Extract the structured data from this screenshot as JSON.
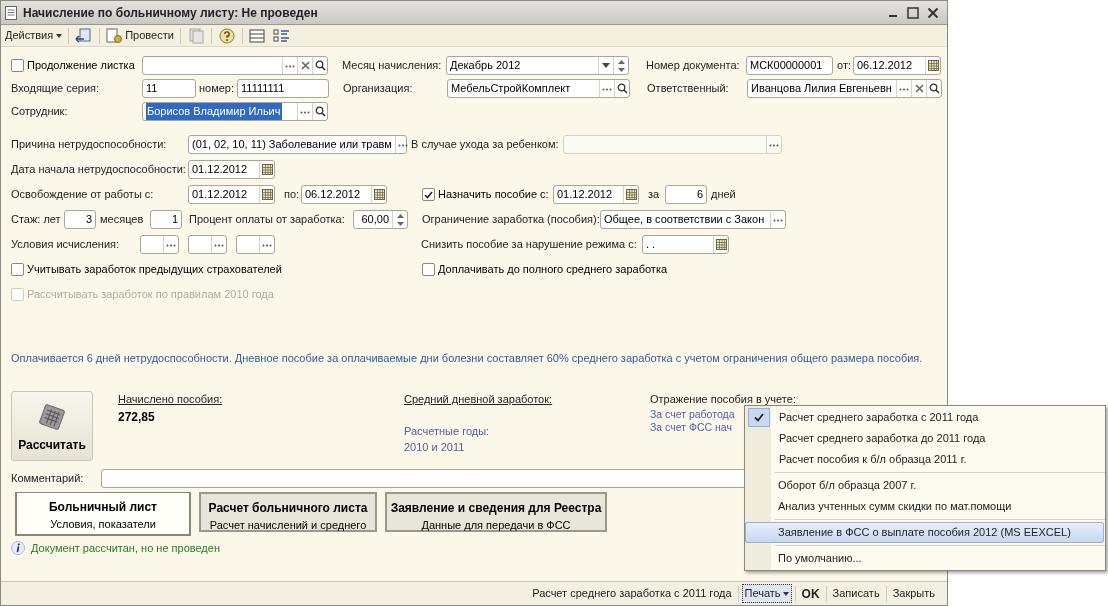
{
  "window": {
    "title": "Начисление по больничному листу: Не проведен"
  },
  "toolbar": {
    "actions": "Действия",
    "post": "Провести"
  },
  "header": {
    "continuation": {
      "label": "Продолжение листка",
      "checked": false
    },
    "series": {
      "label": "Входящие серия:",
      "value": "11"
    },
    "number": {
      "label": "номер:",
      "value": "11111111"
    },
    "employee": {
      "label": "Сотрудник:",
      "value": "Борисов Владимир Ильич",
      "selected": true
    },
    "month": {
      "label": "Месяц начисления:",
      "value": "Декабрь 2012"
    },
    "organization": {
      "label": "Организация:",
      "value": "МебельСтройКомплект"
    },
    "doc_number": {
      "label": "Номер документа:",
      "value": "МСК00000001"
    },
    "doc_date": {
      "label": "от:",
      "value": "06.12.2012"
    },
    "responsible": {
      "label": "Ответственный:",
      "value": "Иванцова Лилия Евгеньевн"
    }
  },
  "conditions": {
    "reason": {
      "label": "Причина нетрудоспособности:",
      "value": "(01, 02, 10, 11) Заболевание или травм"
    },
    "child_care": {
      "label": "В случае ухода за ребенком:",
      "disabled": true
    },
    "start_date": {
      "label": "Дата начала нетрудоспособности:",
      "value": "01.12.2012"
    },
    "release_from": {
      "label": "Освобождение от работы с:",
      "value": "01.12.2012"
    },
    "release_to": {
      "label": "по:",
      "value": "06.12.2012"
    },
    "assign": {
      "label": "Назначить пособие с:",
      "checked": true,
      "value": "01.12.2012"
    },
    "days": {
      "label": "за",
      "value": "6",
      "unit": "дней"
    },
    "years": {
      "label": "Стаж: лет",
      "value": "3"
    },
    "months": {
      "label": "месяцев",
      "value": "1"
    },
    "percent": {
      "label": "Процент оплаты от заработка:",
      "value": "60,00"
    },
    "limit": {
      "label": "Ограничение заработка (пособия):",
      "value": "Общее, в соответствии с Закон"
    },
    "calc_conditions": {
      "label": "Условия исчисления:"
    },
    "reduce": {
      "label": "Снизить пособие за нарушение режима с:",
      "value": " .  ."
    },
    "prev_insurers": {
      "label": "Учитывать заработок предыдущих страхователей",
      "checked": false,
      "disabled": false
    },
    "full_average": {
      "label": "Доплачивать до полного среднего заработка",
      "checked": false,
      "disabled": false
    },
    "rules_2010": {
      "label": "Рассчитывать заработок по правилам 2010 года",
      "checked": false,
      "disabled": true
    }
  },
  "info_text": "Оплачивается 6 дней нетрудоспособности. Дневное пособие за оплачиваемые дни болезни составляет 60% среднего заработка с учетом ограничения общего размера пособия.",
  "calculate_button": "Рассчитать",
  "accrued": {
    "label": "Начислено пособия:",
    "value": "272,85"
  },
  "average": {
    "label": "Средний дневной заработок:",
    "years_label": "Расчетные годы:",
    "years": "2010 и 2011"
  },
  "accounting": {
    "label": "Отражение пособия в учете:",
    "links": [
      "За счет работода",
      "За счет ФСС нач"
    ]
  },
  "comment": {
    "label": "Комментарий:"
  },
  "tabs": [
    {
      "title": "Больничный лист",
      "subtitle": "Условия, показатели",
      "selected": true
    },
    {
      "title": "Расчет больничного листа",
      "subtitle": "Расчет начислений и среднего",
      "selected": false
    },
    {
      "title": "Заявление и сведения для Реестра",
      "subtitle": "Данные для передачи в ФСС",
      "selected": false
    }
  ],
  "status_message": "Документ рассчитан, но не проведен",
  "footer": {
    "print_form": "Расчет среднего заработка с 2011 года",
    "print": "Печать",
    "ok": "OK",
    "save": "Записать",
    "close": "Закрыть"
  },
  "print_menu": [
    [
      {
        "label": "Расчет среднего заработка с 2011 года",
        "checked": true,
        "selected": false
      },
      {
        "label": "Расчет среднего заработка до 2011 года",
        "checked": false,
        "selected": false
      },
      {
        "label": "Расчет пособия к б/л образца 2011 г.",
        "checked": false,
        "selected": false
      }
    ],
    [
      {
        "label": "Оборот б/л образца 2007 г.",
        "checked": false,
        "selected": false
      },
      {
        "label": "Анализ учтенных сумм скидки по мат.помощи",
        "checked": false,
        "selected": false
      }
    ],
    [
      {
        "label": "Заявление в ФСС о выплате пособия 2012 (MS EEXCEL)",
        "checked": false,
        "selected": true
      }
    ],
    [
      {
        "label": "По умолчанию...",
        "checked": false,
        "selected": false
      }
    ]
  ]
}
